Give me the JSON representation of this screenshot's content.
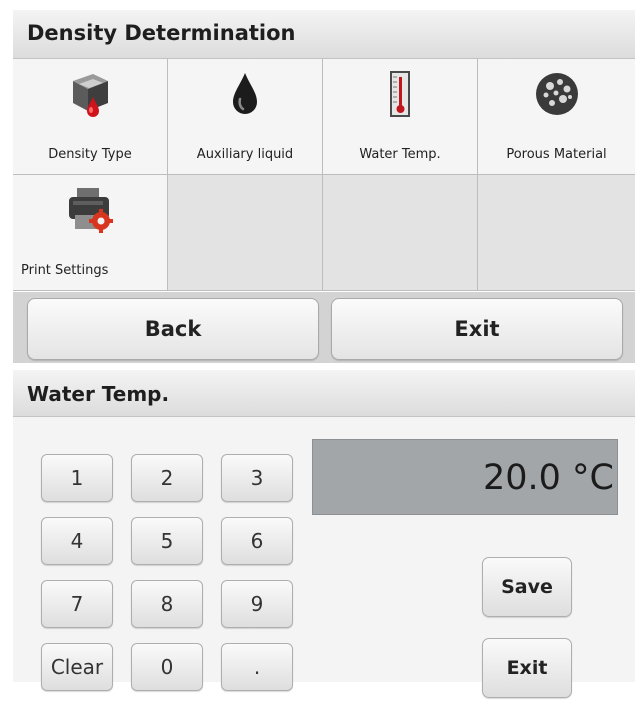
{
  "menu_panel": {
    "title": "Density Determination",
    "items": [
      {
        "label": "Density Type",
        "icon": "density-cube-icon"
      },
      {
        "label": "Auxiliary liquid",
        "icon": "liquid-drop-icon"
      },
      {
        "label": "Water Temp.",
        "icon": "thermometer-icon"
      },
      {
        "label": "Porous Material",
        "icon": "porous-ball-icon"
      },
      {
        "label": "Print Settings",
        "icon": "printer-gear-icon"
      }
    ],
    "back_label": "Back",
    "exit_label": "Exit"
  },
  "keypad_panel": {
    "title": "Water Temp.",
    "keys": [
      "1",
      "2",
      "3",
      "4",
      "5",
      "6",
      "7",
      "8",
      "9",
      "Clear",
      "0",
      "."
    ],
    "display_value": "20.0 °C",
    "save_label": "Save",
    "exit_label": "Exit"
  }
}
